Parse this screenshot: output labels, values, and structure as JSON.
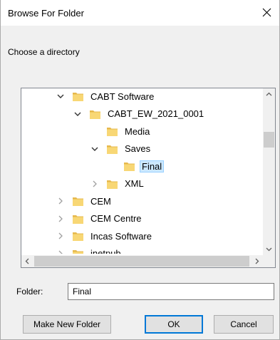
{
  "window": {
    "title": "Browse For Folder"
  },
  "prompt": "Choose a directory",
  "tree": {
    "items": [
      {
        "label": "CABT Software",
        "depth": 0,
        "expander": "expanded",
        "selected": false
      },
      {
        "label": "CABT_EW_2021_0001",
        "depth": 1,
        "expander": "expanded",
        "selected": false
      },
      {
        "label": "Media",
        "depth": 2,
        "expander": "none",
        "selected": false
      },
      {
        "label": "Saves",
        "depth": 2,
        "expander": "expanded",
        "selected": false
      },
      {
        "label": "Final",
        "depth": 3,
        "expander": "none",
        "selected": true
      },
      {
        "label": "XML",
        "depth": 2,
        "expander": "collapsed",
        "selected": false
      },
      {
        "label": "CEM",
        "depth": 0,
        "expander": "collapsed",
        "selected": false
      },
      {
        "label": "CEM Centre",
        "depth": 0,
        "expander": "collapsed",
        "selected": false
      },
      {
        "label": "Incas Software",
        "depth": 0,
        "expander": "collapsed",
        "selected": false
      },
      {
        "label": "inetpub",
        "depth": 0,
        "expander": "collapsed",
        "selected": false
      }
    ]
  },
  "folder_field": {
    "label": "Folder:",
    "value": "Final"
  },
  "buttons": {
    "make_new_folder": "Make New Folder",
    "ok": "OK",
    "cancel": "Cancel"
  },
  "colors": {
    "folder": "#f8d775",
    "folder_dark": "#e6b84c",
    "selection": "#cce8ff",
    "selection_border": "#99d1ff",
    "accent": "#0078d7"
  }
}
